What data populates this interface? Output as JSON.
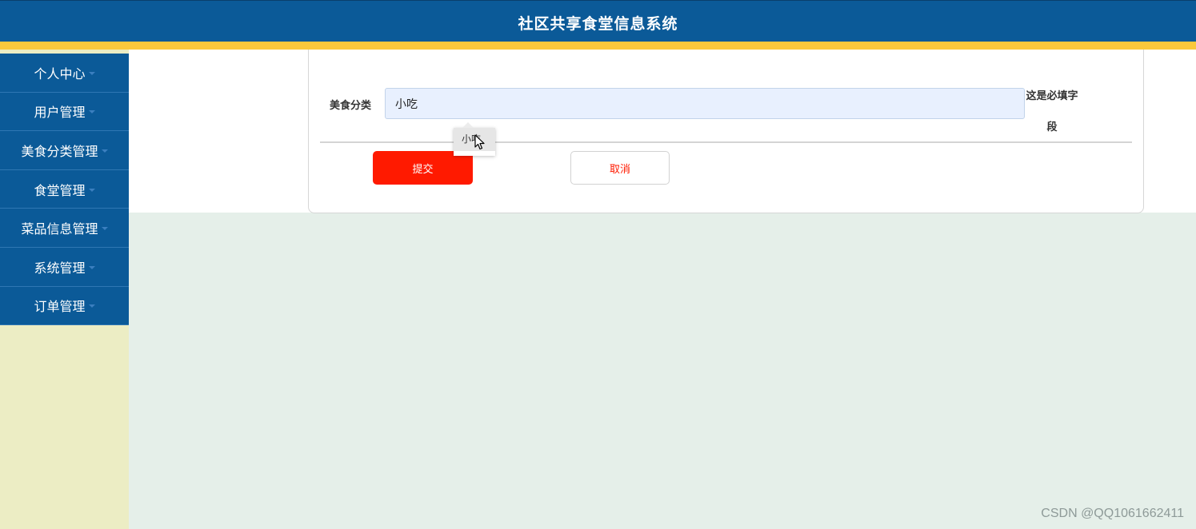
{
  "header": {
    "title": "社区共享食堂信息系统"
  },
  "colors": {
    "primary": "#0b5a98",
    "accent_bar": "#fac83c",
    "submit": "#ff1a00",
    "sidebar_bg": "#ecedc4",
    "page_bg": "#e5efe9"
  },
  "sidebar": {
    "items": [
      {
        "label": "个人中心"
      },
      {
        "label": "用户管理"
      },
      {
        "label": "美食分类管理"
      },
      {
        "label": "食堂管理"
      },
      {
        "label": "菜品信息管理"
      },
      {
        "label": "系统管理"
      },
      {
        "label": "订单管理"
      }
    ]
  },
  "form": {
    "field_label": "美食分类",
    "field_value": "小吃",
    "required_hint_line1": "这是必填字",
    "required_hint_line2": "段",
    "autocomplete_option": "小吃",
    "submit_label": "提交",
    "cancel_label": "取消"
  },
  "watermark": "CSDN @QQ1061662411"
}
